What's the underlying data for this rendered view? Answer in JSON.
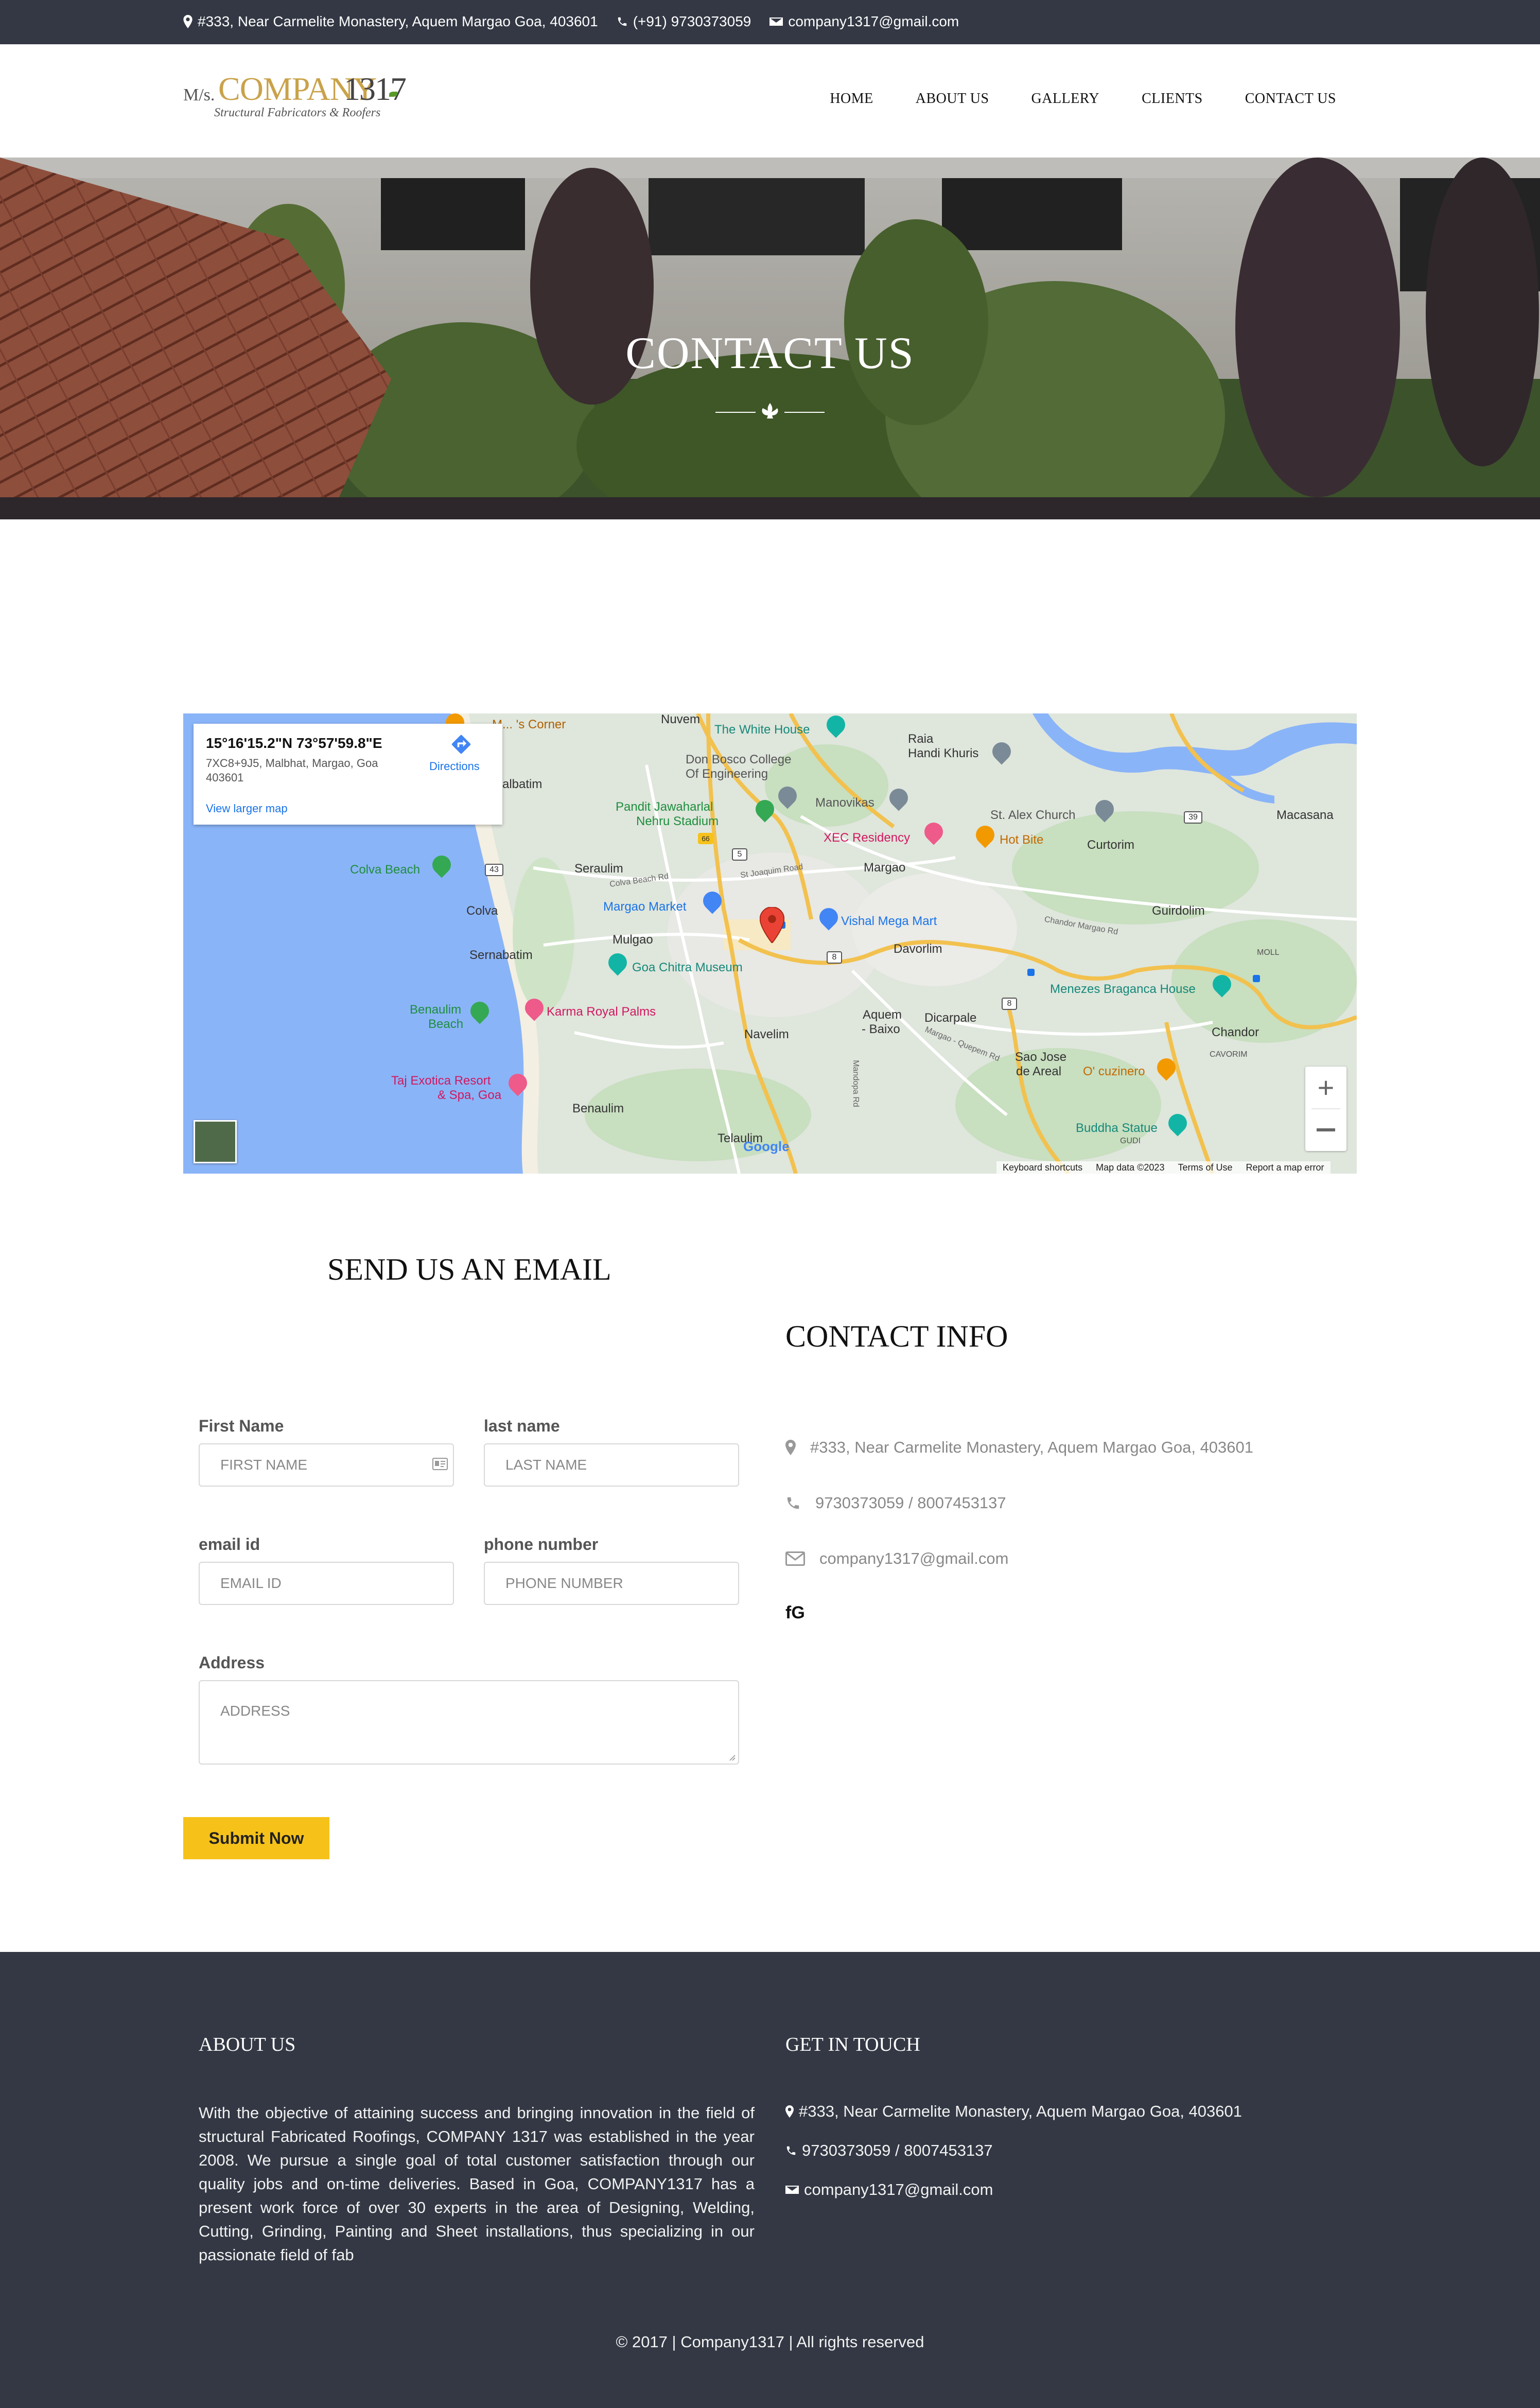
{
  "topbar": {
    "address": "#333, Near Carmelite Monastery, Aquem Margao Goa, 403601",
    "phone": "(+91) 9730373059",
    "email": "company1317@gmail.com"
  },
  "logo": {
    "prefix": "M/s.",
    "name": "COMPANY",
    "number": "1317",
    "tagline": "Structural Fabricators & Roofers"
  },
  "nav": {
    "items": [
      {
        "label": "HOME"
      },
      {
        "label": "ABOUT US"
      },
      {
        "label": "GALLERY"
      },
      {
        "label": "CLIENTS"
      },
      {
        "label": "CONTACT US"
      }
    ]
  },
  "hero": {
    "title": "CONTACT US"
  },
  "map": {
    "coords": "15°16'15.2\"N 73°57'59.8\"E",
    "plus_code": "7XC8+9J5, Malbhat, Margao, Goa",
    "postcode": "403601",
    "directions": "Directions",
    "view_larger": "View larger map",
    "footer_links": [
      "Keyboard shortcuts",
      "Map data ©2023",
      "Terms of Use",
      "Report a map error"
    ],
    "places": {
      "nuvem": "Nuvem",
      "white_house": "The White House",
      "raia": "Raia",
      "handi_khuris": "Handi Khuris",
      "macasana": "Macasana",
      "don_bosco_1": "Don Bosco College",
      "don_bosco_2": "Of Engineering",
      "malbatim": "albatim",
      "corner": "M... 's Corner",
      "pandit_1": "Pandit Jawaharlal",
      "pandit_2": "Nehru Stadium",
      "manovikas": "Manovikas",
      "st_alex": "St. Alex Church",
      "xec": "XEC Residency",
      "hot_bite": "Hot Bite",
      "curtorim": "Curtorim",
      "colva_beach": "Colva Beach",
      "seraulim": "Seraulim",
      "colva_beach_rd": "Colva Beach Rd",
      "st_joaquim": "St Joaquim Road",
      "margao": "Margao",
      "guirdolim": "Guirdolim",
      "colva": "Colva",
      "margao_market": "Margao Market",
      "vishal": "Vishal Mega Mart",
      "chandor_margao": "Chandor Margao Rd",
      "mulgao": "Mulgao",
      "sernabatim": "Sernabatim",
      "davorlim": "Davorlim",
      "moll": "MOLL",
      "goa_chitra": "Goa Chitra Museum",
      "menezes": "Menezes Braganca House",
      "benaulim_beach_1": "Benaulim",
      "benaulim_beach_2": "Beach",
      "karma": "Karma Royal Palms",
      "aquem_1": "Aquem",
      "aquem_2": "- Baixo",
      "dicarpale": "Dicarpale",
      "chandor": "Chandor",
      "navelim": "Navelim",
      "cavorim": "CAVORIM",
      "margao_quepem": "Margao - Quepem Rd",
      "sao_jose_1": "Sao Jose",
      "sao_jose_2": "de Areal",
      "cuzinero": "O' cuzinero",
      "taj_1": "Taj Exotica Resort",
      "taj_2": "& Spa, Goa",
      "benaulim": "Benaulim",
      "mandopa": "Mandopa Rd",
      "buddha": "Buddha Statue",
      "gudi": "GUDI",
      "telaulim": "Telaulim",
      "google": "Google",
      "shield_66": "66",
      "shield_5": "5",
      "shield_43": "43",
      "shield_39": "39",
      "shield_8a": "8",
      "shield_8b": "8"
    }
  },
  "form": {
    "title": "SEND US AN EMAIL",
    "first_name_label": "First Name",
    "first_name_placeholder": "FIRST NAME",
    "last_name_label": "last name",
    "last_name_placeholder": "LAST NAME",
    "email_label": "email id",
    "email_placeholder": "EMAIL ID",
    "phone_label": "phone number",
    "phone_placeholder": "PHONE NUMBER",
    "address_label": "Address",
    "address_placeholder": "ADDRESS",
    "submit": "Submit Now"
  },
  "contact_info": {
    "title": "CONTACT INFO",
    "address": "#333, Near Carmelite Monastery, Aquem Margao Goa, 403601",
    "phones": "9730373059 / 8007453137",
    "email": "company1317@gmail.com",
    "social": "fG"
  },
  "footer": {
    "about_title": "ABOUT US",
    "about_text": "With the objective of attaining success and bringing innovation in the field of structural Fabricated Roofings, COMPANY 1317 was established in the year 2008. We pursue a single goal of total customer satisfaction through our quality jobs and on-time deliveries. Based in Goa, COMPANY1317 has a present work force of over 30 experts in the area of Designing, Welding, Cutting, Grinding, Painting and Sheet installations, thus specializing in our passionate field of fab",
    "touch_title": "GET IN TOUCH",
    "address": "#333, Near Carmelite Monastery, Aquem Margao Goa, 403601",
    "phones": "9730373059 / 8007453137",
    "email": "company1317@gmail.com",
    "copyright": "© 2017 | Company1317 | All rights reserved"
  },
  "colors": {
    "dark": "#333844",
    "accent": "#f6c21a",
    "logo_gold": "#c9a24a"
  },
  "icons": [
    "map-marker-icon",
    "phone-icon",
    "envelope-icon",
    "id-card-icon",
    "directions-icon",
    "zoom-in-icon",
    "zoom-out-icon",
    "fleur-de-lis-icon",
    "map-pin-icon"
  ]
}
